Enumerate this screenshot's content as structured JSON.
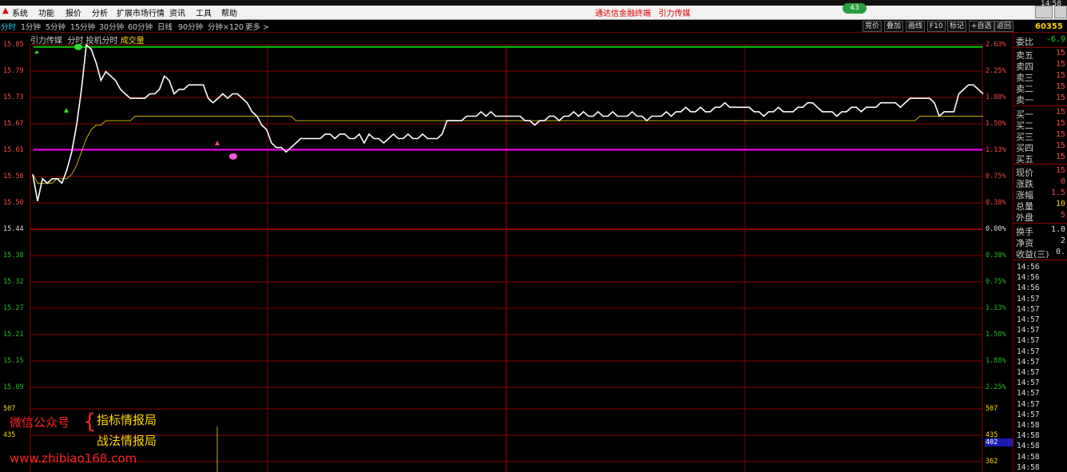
{
  "menubar": {
    "items": [
      "系统",
      "功能",
      "报价",
      "分析",
      "扩展市场行情",
      "资讯",
      "工具",
      "帮助"
    ],
    "center_title": "通达信金融终端",
    "center_sub": "引力传媒",
    "badge": "43"
  },
  "toolbar": {
    "periods": [
      "分时",
      "1分钟",
      "5分钟",
      "15分钟",
      "30分钟",
      "60分钟",
      "日线",
      "90分钟",
      "分钟×120",
      "更多 >"
    ],
    "buttons": [
      "竞价",
      "叠加",
      "画线",
      "F10",
      "标记",
      "+自选",
      "返回"
    ]
  },
  "chart_header": {
    "name": "引力传媒",
    "labels": [
      "分时",
      "投机分时",
      "成交量"
    ]
  },
  "axes": {
    "left_price": [
      "15.85",
      "15.79",
      "15.73",
      "15.67",
      "15.61",
      "15.56",
      "15.50",
      "15.44",
      "15.38",
      "15.32",
      "15.27",
      "15.21",
      "15.15",
      "15.09"
    ],
    "right_pct": [
      "2.63%",
      "2.25%",
      "1.88%",
      "1.50%",
      "1.13%",
      "0.75%",
      "0.38%",
      "0.00%",
      "0.38%",
      "0.75%",
      "1.13%",
      "1.50%",
      "1.88%",
      "2.25%"
    ],
    "vol_left": [
      "507",
      "435"
    ],
    "vol_right": [
      "507",
      "435",
      "362"
    ],
    "vol_current": "402"
  },
  "right_panel": {
    "top_time": "14:58",
    "code": "60355",
    "weibi_label": "委比",
    "weibi_value": "-6.9",
    "rows": [
      {
        "label": "卖五",
        "value": "15"
      },
      {
        "label": "卖四",
        "value": "15"
      },
      {
        "label": "卖三",
        "value": "15"
      },
      {
        "label": "卖二",
        "value": "15"
      },
      {
        "label": "卖一",
        "value": "15"
      },
      {
        "label": "买一",
        "value": "15"
      },
      {
        "label": "买二",
        "value": "15"
      },
      {
        "label": "买三",
        "value": "15"
      },
      {
        "label": "买四",
        "value": "15"
      },
      {
        "label": "买五",
        "value": "15"
      },
      {
        "label": "现价",
        "value": "15"
      },
      {
        "label": "涨跌",
        "value": "0"
      },
      {
        "label": "涨幅",
        "value": "1.5"
      },
      {
        "label": "总量",
        "value": "10"
      },
      {
        "label": "外盘",
        "value": "5"
      },
      {
        "label": "换手",
        "value": "1.0"
      },
      {
        "label": "净资",
        "value": "2"
      },
      {
        "label": "收益(三)",
        "value": "0."
      }
    ],
    "times": [
      "14:56",
      "14:56",
      "14:56",
      "14:57",
      "14:57",
      "14:57",
      "14:57",
      "14:57",
      "14:57",
      "14:57",
      "14:57",
      "14:57",
      "14:57",
      "14:57",
      "14:57",
      "14:58",
      "14:58",
      "14:58",
      "14:58",
      "14:58"
    ]
  },
  "watermark": {
    "line1": "微信公众号",
    "brace": "{",
    "item_a": "指标情报局",
    "item_b": "战法情报局",
    "url": "www.zhibiao168.com"
  },
  "colors": {
    "price_line": "#ffffff",
    "avg_line": "#c8b000",
    "high_line": "#00cc00",
    "low_line": "#ff00ff",
    "grid": "#8b0000",
    "up_text": "#ff4444"
  },
  "chart_data": {
    "type": "line",
    "ylim": [
      15.03,
      15.85
    ],
    "series": [
      {
        "values": [
          15.56,
          15.5,
          15.55,
          15.54,
          15.55,
          15.55,
          15.54,
          15.57,
          15.61,
          15.67,
          15.75,
          15.85,
          15.84,
          15.81,
          15.77,
          15.79,
          15.78,
          15.77,
          15.75,
          15.74,
          15.73,
          15.73,
          15.73,
          15.73,
          15.74,
          15.74,
          15.75,
          15.78,
          15.77,
          15.74,
          15.75,
          15.75,
          15.76,
          15.76,
          15.76,
          15.76,
          15.73,
          15.72,
          15.73,
          15.74,
          15.73,
          15.74,
          15.74,
          15.73,
          15.72,
          15.7,
          15.69,
          15.67,
          15.66,
          15.63,
          15.62,
          15.62,
          15.61,
          15.62,
          15.63,
          15.64,
          15.64,
          15.64,
          15.64,
          15.64,
          15.65,
          15.65,
          15.64,
          15.65,
          15.65,
          15.64,
          15.64,
          15.65,
          15.63,
          15.65,
          15.64,
          15.64,
          15.63,
          15.64,
          15.65,
          15.64,
          15.64,
          15.65,
          15.64,
          15.64,
          15.65,
          15.64,
          15.64,
          15.64,
          15.65,
          15.68,
          15.68,
          15.68,
          15.68,
          15.69,
          15.69,
          15.69,
          15.7,
          15.69,
          15.7,
          15.69,
          15.69,
          15.69,
          15.69,
          15.69,
          15.69,
          15.68,
          15.68,
          15.67,
          15.68,
          15.68,
          15.69,
          15.69,
          15.68,
          15.69,
          15.69,
          15.7,
          15.69,
          15.7,
          15.69,
          15.69,
          15.7,
          15.69,
          15.69,
          15.7,
          15.69,
          15.69,
          15.69,
          15.7,
          15.69,
          15.69,
          15.68,
          15.69,
          15.69,
          15.69,
          15.7,
          15.69,
          15.7,
          15.7,
          15.71,
          15.7,
          15.7,
          15.71,
          15.7,
          15.7,
          15.71,
          15.71,
          15.72,
          15.71,
          15.71,
          15.71,
          15.71,
          15.71,
          15.7,
          15.7,
          15.69,
          15.7,
          15.7,
          15.71,
          15.7,
          15.7,
          15.7,
          15.71,
          15.71,
          15.72,
          15.72,
          15.71,
          15.7,
          15.7,
          15.7,
          15.69,
          15.7,
          15.7,
          15.71,
          15.71,
          15.7,
          15.71,
          15.71,
          15.71,
          15.72,
          15.72,
          15.72,
          15.72,
          15.71,
          15.72,
          15.73,
          15.73,
          15.73,
          15.73,
          15.73,
          15.72,
          15.69,
          15.7,
          15.7,
          15.7,
          15.74,
          15.75,
          15.76,
          15.76,
          15.75,
          15.74
        ]
      },
      {
        "values": [
          15.56,
          15.54,
          15.54,
          15.54,
          15.54,
          15.55,
          15.55,
          15.55,
          15.56,
          15.58,
          15.61,
          15.64,
          15.66,
          15.67,
          15.67,
          15.68,
          15.68,
          15.68,
          15.68,
          15.68,
          15.68,
          15.69,
          15.69,
          15.69,
          15.69,
          15.69,
          15.69,
          15.69,
          15.69,
          15.69,
          15.69,
          15.69,
          15.69,
          15.69,
          15.69,
          15.69,
          15.69,
          15.69,
          15.69,
          15.69,
          15.69,
          15.69,
          15.69,
          15.69,
          15.69,
          15.69,
          15.69,
          15.69,
          15.69,
          15.69,
          15.69,
          15.69,
          15.69,
          15.69,
          15.68,
          15.68,
          15.68,
          15.68,
          15.68,
          15.68,
          15.68,
          15.68,
          15.68,
          15.68,
          15.68,
          15.68,
          15.68,
          15.68,
          15.68,
          15.68,
          15.68,
          15.68,
          15.68,
          15.68,
          15.68,
          15.68,
          15.68,
          15.68,
          15.68,
          15.68,
          15.68,
          15.68,
          15.68,
          15.68,
          15.68,
          15.68,
          15.68,
          15.68,
          15.68,
          15.68,
          15.68,
          15.68,
          15.68,
          15.68,
          15.68,
          15.68,
          15.68,
          15.68,
          15.68,
          15.68,
          15.68,
          15.68,
          15.68,
          15.68,
          15.68,
          15.68,
          15.68,
          15.68,
          15.68,
          15.68,
          15.68,
          15.68,
          15.68,
          15.68,
          15.68,
          15.68,
          15.68,
          15.68,
          15.68,
          15.68,
          15.68,
          15.68,
          15.68,
          15.68,
          15.68,
          15.68,
          15.68,
          15.68,
          15.68,
          15.68,
          15.68,
          15.68,
          15.68,
          15.68,
          15.68,
          15.68,
          15.68,
          15.68,
          15.68,
          15.68,
          15.68,
          15.68,
          15.68,
          15.68,
          15.68,
          15.68,
          15.68,
          15.68,
          15.68,
          15.68,
          15.68,
          15.68,
          15.68,
          15.68,
          15.68,
          15.68,
          15.68,
          15.68,
          15.68,
          15.68,
          15.68,
          15.68,
          15.68,
          15.68,
          15.68,
          15.68,
          15.68,
          15.68,
          15.68,
          15.68,
          15.68,
          15.68,
          15.68,
          15.68,
          15.68,
          15.68,
          15.68,
          15.68,
          15.68,
          15.68,
          15.68,
          15.68,
          15.69,
          15.69,
          15.69,
          15.69,
          15.69,
          15.69,
          15.69,
          15.69,
          15.69,
          15.69,
          15.69,
          15.69,
          15.69,
          15.69
        ]
      }
    ],
    "hlines": [
      15.845,
      15.615,
      15.44
    ]
  }
}
